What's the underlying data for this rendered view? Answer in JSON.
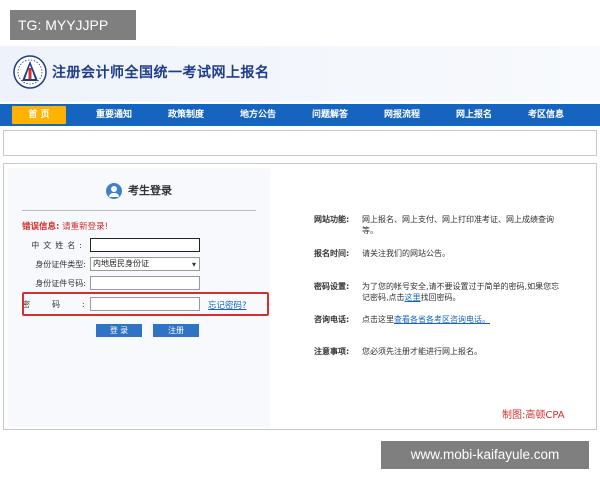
{
  "watermark": {
    "top": "TG: MYYJJPP",
    "bottom": "www.mobi-kaifayule.com"
  },
  "header": {
    "logo_icon": "exam-logo-icon",
    "title": "注册会计师全国统一考试网上报名"
  },
  "nav": {
    "items": [
      {
        "label": "首 页",
        "active": true
      },
      {
        "label": "重要通知"
      },
      {
        "label": "政策制度"
      },
      {
        "label": "地方公告"
      },
      {
        "label": "问题解答"
      },
      {
        "label": "网报流程"
      },
      {
        "label": "网上报名"
      },
      {
        "label": "考区信息"
      }
    ]
  },
  "login": {
    "title": "考生登录",
    "error_label": "错误信息:",
    "error_text": "请重新登录!",
    "fields": {
      "name_label": "中文姓名:",
      "name_value": "",
      "idtype_label": "身份证件类型:",
      "idtype_value": "内地居民身份证",
      "idno_label": "身份证件号码:",
      "idno_value": "",
      "password_label": "密码:",
      "password_value": ""
    },
    "forgot_link": "忘记密码?",
    "login_button": "登 录",
    "register_button": "注册"
  },
  "info": {
    "function_key": "网站功能:",
    "function_val": "网上报名、网上支付、网上打印准考证、网上成绩查询等。",
    "time_key": "报名时间:",
    "time_val": "请关注我们的网站公告。",
    "password_key": "密码设置:",
    "password_val_1": "为了您的帐号安全,请不要设置过于简单的密码,如果您忘记密码,点击",
    "password_link": "这里",
    "password_val_2": "找回密码。",
    "phone_key": "咨询电话:",
    "phone_val_1": "点击这里",
    "phone_link": "查看各省各考区咨询电话。",
    "notice_key": "注意事项:",
    "notice_val": "您必须先注册才能进行网上报名。"
  },
  "credit": "制图:高顿CPA",
  "colors": {
    "nav_bg": "#1565c0",
    "nav_active": "#ffb300",
    "title": "#1f3c88",
    "error": "#d32f2f",
    "button": "#2f73c7"
  }
}
